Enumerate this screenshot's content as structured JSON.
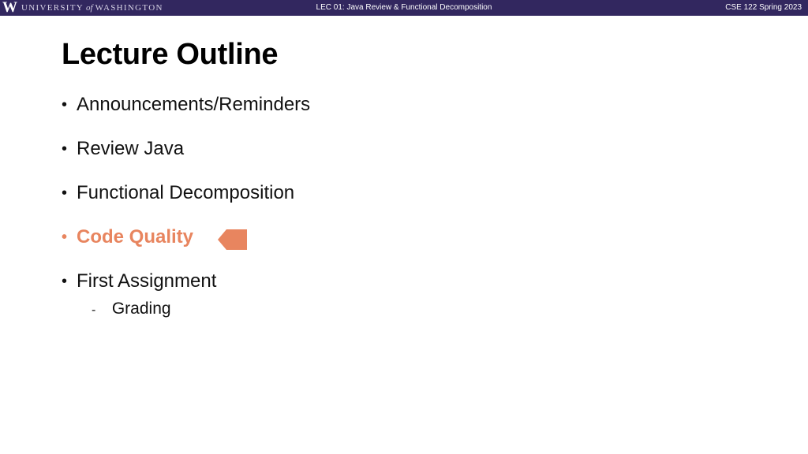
{
  "header": {
    "logo_mark": "W",
    "university_pre": "UNIVERSITY",
    "university_of": "of",
    "university_post": "WASHINGTON",
    "lecture_title": "LEC 01: Java Review & Functional Decomposition",
    "course_term": "CSE 122 Spring 2023"
  },
  "slide": {
    "title": "Lecture Outline",
    "items": [
      {
        "label": "Announcements/Reminders",
        "active": false
      },
      {
        "label": "Review Java",
        "active": false
      },
      {
        "label": "Functional Decomposition",
        "active": false
      },
      {
        "label": "Code Quality",
        "active": true
      },
      {
        "label": "First Assignment",
        "active": false,
        "subitems": [
          {
            "label": "Grading"
          }
        ]
      }
    ],
    "bullet_glyph": "•",
    "sub_bullet_glyph": "-",
    "current_marker_icon": "arrow-left-icon"
  },
  "colors": {
    "header_bg": "#32275f",
    "accent": "#e8855f",
    "text": "#111111"
  }
}
